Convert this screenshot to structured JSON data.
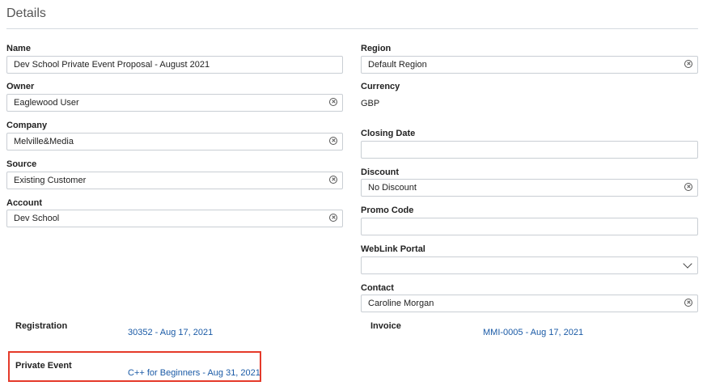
{
  "page": {
    "title": "Details"
  },
  "left": {
    "name": {
      "label": "Name",
      "value": "Dev School Private Event Proposal - August 2021"
    },
    "owner": {
      "label": "Owner",
      "value": "Eaglewood User"
    },
    "company": {
      "label": "Company",
      "value": "Melville&Media"
    },
    "source": {
      "label": "Source",
      "value": "Existing Customer"
    },
    "account": {
      "label": "Account",
      "value": "Dev School"
    }
  },
  "right": {
    "region": {
      "label": "Region",
      "value": "Default Region"
    },
    "currency": {
      "label": "Currency",
      "value": "GBP"
    },
    "closing_date": {
      "label": "Closing Date",
      "value": ""
    },
    "discount": {
      "label": "Discount",
      "value": "No Discount"
    },
    "promo_code": {
      "label": "Promo Code",
      "value": ""
    },
    "weblink_portal": {
      "label": "WebLink Portal",
      "value": ""
    },
    "contact": {
      "label": "Contact",
      "value": "Caroline Morgan"
    }
  },
  "related": {
    "registration": {
      "label": "Registration",
      "link": "30352 - Aug 17, 2021"
    },
    "invoice": {
      "label": "Invoice",
      "link": "MMI-0005 - Aug 17, 2021"
    },
    "private_event": {
      "label": "Private Event",
      "link": "C++ for Beginners - Aug 31, 2021"
    }
  },
  "colors": {
    "link": "#1a5aa6",
    "highlight": "#e53a2a"
  },
  "icons": {
    "clear": "clear-circle-icon",
    "dropdown": "chevron-down-icon"
  }
}
